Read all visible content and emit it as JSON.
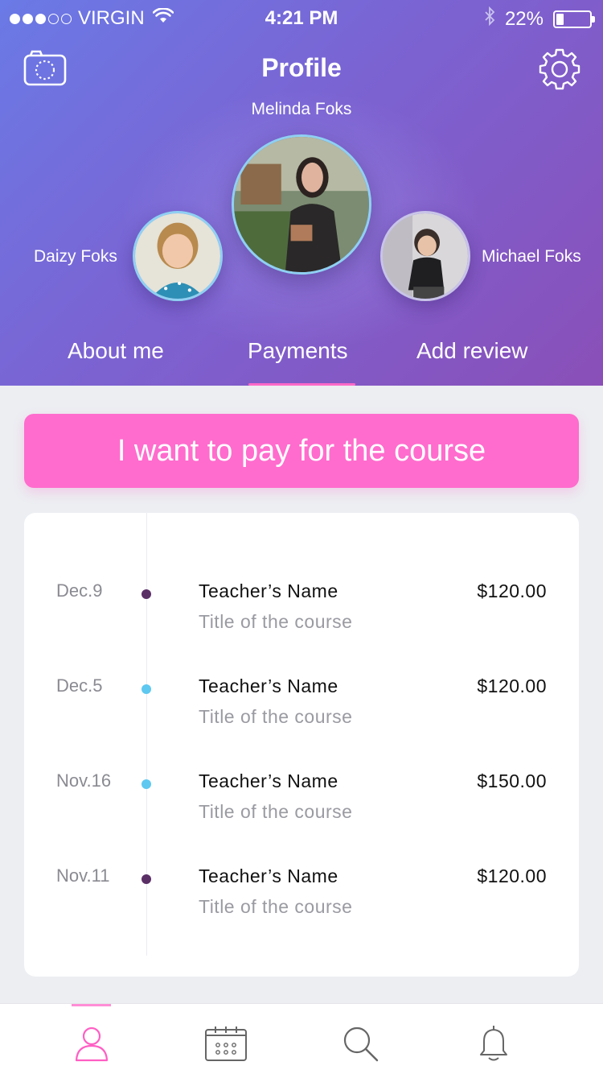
{
  "status_bar": {
    "carrier": "VIRGIN",
    "time": "4:21 PM",
    "battery": "22%",
    "battery_level": 0.22
  },
  "header": {
    "title": "Profile",
    "left_icon": "camera-icon",
    "right_icon": "gear-icon"
  },
  "profiles": {
    "main": {
      "name": "Melinda Foks"
    },
    "left": {
      "name": "Daizy Foks"
    },
    "right": {
      "name": "Michael Foks"
    }
  },
  "tabs": [
    {
      "label": "About me",
      "active": false
    },
    {
      "label": "Payments",
      "active": true
    },
    {
      "label": "Add review",
      "active": false
    }
  ],
  "pay_button": {
    "label": "I want to pay for the course"
  },
  "payments": [
    {
      "date": "Dec.9",
      "teacher": "Teacher’s Name",
      "course": "Title of the course",
      "amount": "$120.00",
      "dot_color": "#5a2f66"
    },
    {
      "date": "Dec.5",
      "teacher": "Teacher’s Name",
      "course": "Title of the course",
      "amount": "$120.00",
      "dot_color": "#5ec8f0"
    },
    {
      "date": "Nov.16",
      "teacher": "Teacher’s Name",
      "course": "Title of the course",
      "amount": "$150.00",
      "dot_color": "#5ec8f0"
    },
    {
      "date": "Nov.11",
      "teacher": "Teacher’s Name",
      "course": "Title of the course",
      "amount": "$120.00",
      "dot_color": "#5a2f66"
    }
  ],
  "tab_bar": [
    {
      "icon": "profile-icon",
      "active": true
    },
    {
      "icon": "calendar-icon",
      "active": false
    },
    {
      "icon": "search-icon",
      "active": false
    },
    {
      "icon": "bell-icon",
      "active": false
    }
  ],
  "colors": {
    "accent": "#ff6ccd",
    "header_start": "#6a7ae6",
    "header_end": "#8a4fb8"
  }
}
